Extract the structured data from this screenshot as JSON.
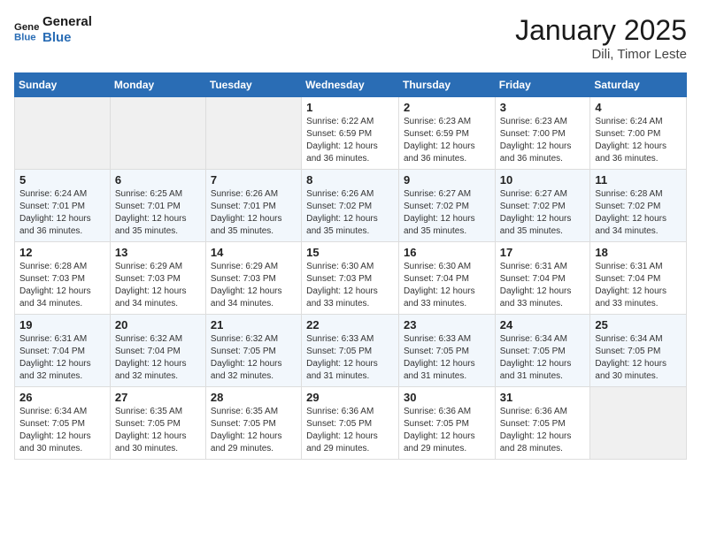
{
  "header": {
    "logo_line1": "General",
    "logo_line2": "Blue",
    "month": "January 2025",
    "location": "Dili, Timor Leste"
  },
  "weekdays": [
    "Sunday",
    "Monday",
    "Tuesday",
    "Wednesday",
    "Thursday",
    "Friday",
    "Saturday"
  ],
  "weeks": [
    [
      {
        "day": "",
        "info": ""
      },
      {
        "day": "",
        "info": ""
      },
      {
        "day": "",
        "info": ""
      },
      {
        "day": "1",
        "info": "Sunrise: 6:22 AM\nSunset: 6:59 PM\nDaylight: 12 hours\nand 36 minutes."
      },
      {
        "day": "2",
        "info": "Sunrise: 6:23 AM\nSunset: 6:59 PM\nDaylight: 12 hours\nand 36 minutes."
      },
      {
        "day": "3",
        "info": "Sunrise: 6:23 AM\nSunset: 7:00 PM\nDaylight: 12 hours\nand 36 minutes."
      },
      {
        "day": "4",
        "info": "Sunrise: 6:24 AM\nSunset: 7:00 PM\nDaylight: 12 hours\nand 36 minutes."
      }
    ],
    [
      {
        "day": "5",
        "info": "Sunrise: 6:24 AM\nSunset: 7:01 PM\nDaylight: 12 hours\nand 36 minutes."
      },
      {
        "day": "6",
        "info": "Sunrise: 6:25 AM\nSunset: 7:01 PM\nDaylight: 12 hours\nand 35 minutes."
      },
      {
        "day": "7",
        "info": "Sunrise: 6:26 AM\nSunset: 7:01 PM\nDaylight: 12 hours\nand 35 minutes."
      },
      {
        "day": "8",
        "info": "Sunrise: 6:26 AM\nSunset: 7:02 PM\nDaylight: 12 hours\nand 35 minutes."
      },
      {
        "day": "9",
        "info": "Sunrise: 6:27 AM\nSunset: 7:02 PM\nDaylight: 12 hours\nand 35 minutes."
      },
      {
        "day": "10",
        "info": "Sunrise: 6:27 AM\nSunset: 7:02 PM\nDaylight: 12 hours\nand 35 minutes."
      },
      {
        "day": "11",
        "info": "Sunrise: 6:28 AM\nSunset: 7:02 PM\nDaylight: 12 hours\nand 34 minutes."
      }
    ],
    [
      {
        "day": "12",
        "info": "Sunrise: 6:28 AM\nSunset: 7:03 PM\nDaylight: 12 hours\nand 34 minutes."
      },
      {
        "day": "13",
        "info": "Sunrise: 6:29 AM\nSunset: 7:03 PM\nDaylight: 12 hours\nand 34 minutes."
      },
      {
        "day": "14",
        "info": "Sunrise: 6:29 AM\nSunset: 7:03 PM\nDaylight: 12 hours\nand 34 minutes."
      },
      {
        "day": "15",
        "info": "Sunrise: 6:30 AM\nSunset: 7:03 PM\nDaylight: 12 hours\nand 33 minutes."
      },
      {
        "day": "16",
        "info": "Sunrise: 6:30 AM\nSunset: 7:04 PM\nDaylight: 12 hours\nand 33 minutes."
      },
      {
        "day": "17",
        "info": "Sunrise: 6:31 AM\nSunset: 7:04 PM\nDaylight: 12 hours\nand 33 minutes."
      },
      {
        "day": "18",
        "info": "Sunrise: 6:31 AM\nSunset: 7:04 PM\nDaylight: 12 hours\nand 33 minutes."
      }
    ],
    [
      {
        "day": "19",
        "info": "Sunrise: 6:31 AM\nSunset: 7:04 PM\nDaylight: 12 hours\nand 32 minutes."
      },
      {
        "day": "20",
        "info": "Sunrise: 6:32 AM\nSunset: 7:04 PM\nDaylight: 12 hours\nand 32 minutes."
      },
      {
        "day": "21",
        "info": "Sunrise: 6:32 AM\nSunset: 7:05 PM\nDaylight: 12 hours\nand 32 minutes."
      },
      {
        "day": "22",
        "info": "Sunrise: 6:33 AM\nSunset: 7:05 PM\nDaylight: 12 hours\nand 31 minutes."
      },
      {
        "day": "23",
        "info": "Sunrise: 6:33 AM\nSunset: 7:05 PM\nDaylight: 12 hours\nand 31 minutes."
      },
      {
        "day": "24",
        "info": "Sunrise: 6:34 AM\nSunset: 7:05 PM\nDaylight: 12 hours\nand 31 minutes."
      },
      {
        "day": "25",
        "info": "Sunrise: 6:34 AM\nSunset: 7:05 PM\nDaylight: 12 hours\nand 30 minutes."
      }
    ],
    [
      {
        "day": "26",
        "info": "Sunrise: 6:34 AM\nSunset: 7:05 PM\nDaylight: 12 hours\nand 30 minutes."
      },
      {
        "day": "27",
        "info": "Sunrise: 6:35 AM\nSunset: 7:05 PM\nDaylight: 12 hours\nand 30 minutes."
      },
      {
        "day": "28",
        "info": "Sunrise: 6:35 AM\nSunset: 7:05 PM\nDaylight: 12 hours\nand 29 minutes."
      },
      {
        "day": "29",
        "info": "Sunrise: 6:36 AM\nSunset: 7:05 PM\nDaylight: 12 hours\nand 29 minutes."
      },
      {
        "day": "30",
        "info": "Sunrise: 6:36 AM\nSunset: 7:05 PM\nDaylight: 12 hours\nand 29 minutes."
      },
      {
        "day": "31",
        "info": "Sunrise: 6:36 AM\nSunset: 7:05 PM\nDaylight: 12 hours\nand 28 minutes."
      },
      {
        "day": "",
        "info": ""
      }
    ]
  ]
}
